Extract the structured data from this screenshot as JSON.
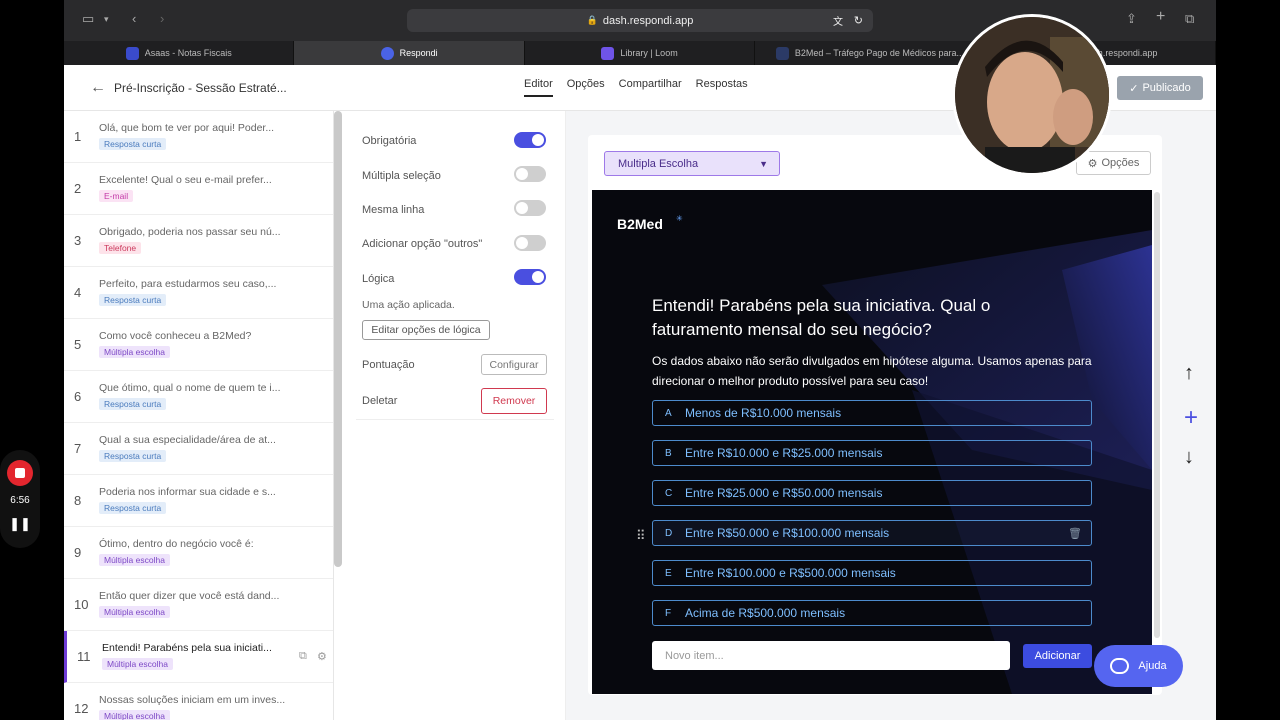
{
  "browser": {
    "address": "dash.respondi.app",
    "tabs": [
      {
        "label": "Asaas - Notas Fiscais",
        "color": "#3a4bcc"
      },
      {
        "label": "Respondi",
        "color": "#4a63e6"
      },
      {
        "label": "Library | Loom",
        "color": "#6f54e8"
      },
      {
        "label": "B2Med – Tráfego Pago de Médicos para...",
        "color": "#2b3a66"
      },
      {
        "label": "dash.respondi.app",
        "color": "#4a63e6"
      }
    ]
  },
  "header": {
    "back_icon": "arrow-left-icon",
    "title": "Pré-Inscrição - Sessão Estraté...",
    "nav": [
      "Editor",
      "Opções",
      "Compartilhar",
      "Respostas"
    ],
    "publish_label": "Publicado"
  },
  "questions": [
    {
      "n": "1",
      "text": "Olá, que bom te ver por aqui! Poder...",
      "badge": "Resposta curta",
      "kind": "short"
    },
    {
      "n": "2",
      "text": "Excelente! Qual o seu e-mail prefer...",
      "badge": "E-mail",
      "kind": "mail"
    },
    {
      "n": "3",
      "text": "Obrigado, poderia nos passar seu nú...",
      "badge": "Telefone",
      "kind": "tel"
    },
    {
      "n": "4",
      "text": "Perfeito, para estudarmos seu caso,...",
      "badge": "Resposta curta",
      "kind": "short"
    },
    {
      "n": "5",
      "text": "Como você conheceu a B2Med?",
      "badge": "Múltipla escolha",
      "kind": "mult"
    },
    {
      "n": "6",
      "text": "Que ótimo, qual o nome de quem te i...",
      "badge": "Resposta curta",
      "kind": "short"
    },
    {
      "n": "7",
      "text": "Qual a sua especialidade/área de at...",
      "badge": "Resposta curta",
      "kind": "short"
    },
    {
      "n": "8",
      "text": "Poderia nos informar sua cidade e s...",
      "badge": "Resposta curta",
      "kind": "short"
    },
    {
      "n": "9",
      "text": "Ótimo, dentro do negócio você é:",
      "badge": "Múltipla escolha",
      "kind": "mult"
    },
    {
      "n": "10",
      "text": "Então quer dizer que você está dand...",
      "badge": "Múltipla escolha",
      "kind": "mult"
    },
    {
      "n": "11",
      "text": "Entendi! Parabéns pela sua iniciati...",
      "badge": "Múltipla escolha",
      "kind": "mult"
    },
    {
      "n": "12",
      "text": "Nossas soluções iniciam em um inves...",
      "badge": "Múltipla escolha",
      "kind": "mult"
    }
  ],
  "settings": {
    "required": "Obrigatória",
    "multi": "Múltipla seleção",
    "sameline": "Mesma linha",
    "other": "Adicionar opção \"outros\"",
    "logic": "Lógica",
    "logic_note": "Uma ação aplicada.",
    "logic_btn": "Editar opções de lógica",
    "score": "Pontuação",
    "score_btn": "Configurar",
    "delete": "Deletar",
    "delete_btn": "Remover"
  },
  "editor": {
    "type": "Multipla Escolha",
    "partial": "Ob",
    "options_btn": "Opções",
    "logo": "B2Med",
    "question": "Entendi! Parabéns pela sua iniciativa. Qual o faturamento mensal do seu negócio?",
    "subtitle": "Os dados abaixo não serão divulgados em hipótese alguma. Usamos apenas para direcionar o melhor produto possível para seu caso!",
    "options": [
      {
        "k": "A",
        "label": "Menos de R$10.000 mensais"
      },
      {
        "k": "B",
        "label": "Entre R$10.000 e R$25.000 mensais"
      },
      {
        "k": "C",
        "label": "Entre R$25.000 e R$50.000 mensais"
      },
      {
        "k": "D",
        "label": "Entre R$50.000 e R$100.000 mensais"
      },
      {
        "k": "E",
        "label": "Entre R$100.000 e R$500.000 mensais"
      },
      {
        "k": "F",
        "label": "Acima de R$500.000 mensais"
      }
    ],
    "new_item_placeholder": "Novo item...",
    "add_label": "Adicionar"
  },
  "help_label": "Ajuda",
  "recorder_time": "6:56",
  "colors": {
    "accent": "#4a4fe0",
    "publish": "#9aa3ad",
    "danger": "#d0394f"
  }
}
